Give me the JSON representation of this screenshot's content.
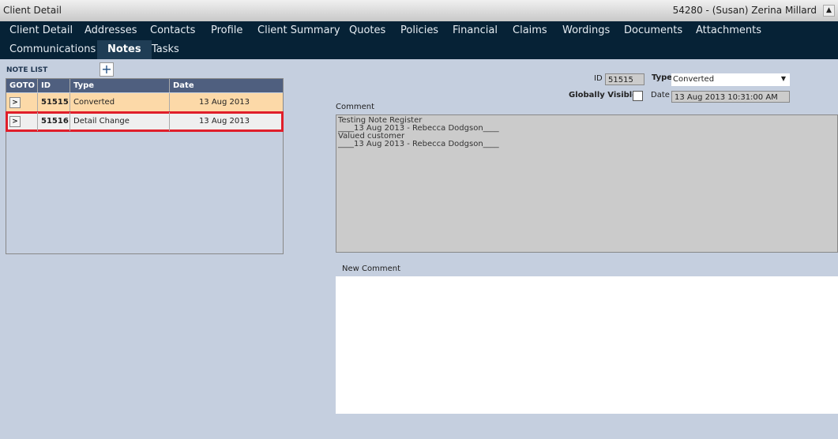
{
  "window": {
    "title": "Client Detail",
    "client": "54280 - (Susan) Zerina Millard",
    "collapse_icon": "chevron-up-icon"
  },
  "tabs": [
    "Client Detail",
    "Addresses",
    "Contacts",
    "Profile",
    "Client Summary",
    "Quotes",
    "Policies",
    "Financial",
    "Claims",
    "Wordings",
    "Documents",
    "Attachments",
    "Communications",
    "Notes",
    "Tasks"
  ],
  "active_tab": "Notes",
  "note_list": {
    "label": "NOTE LIST",
    "add": "+",
    "columns": [
      "GOTO",
      "ID",
      "Type",
      "Date"
    ],
    "rows": [
      {
        "goto": ">",
        "id": "51515",
        "type": "Converted",
        "date": "13 Aug 2013"
      },
      {
        "goto": ">",
        "id": "51516",
        "type": "Detail Change",
        "date": "13 Aug 2013"
      }
    ]
  },
  "detail": {
    "id_label": "ID",
    "id": "51515",
    "type_label": "Type",
    "type": "Converted",
    "visible_label": "Globally Visible",
    "date_label": "Date",
    "date": "13 Aug 2013 10:31:00 AM",
    "comment_label": "Comment",
    "comment_lines": [
      "Testing Note Register",
      "____13 Aug 2013 - Rebecca Dodgson____",
      "Valued customer",
      "____13 Aug 2013 - Rebecca Dodgson____"
    ],
    "new_comment_label": "New Comment",
    "new_comment": ""
  },
  "colors": {
    "nav": "#062236",
    "selected_row": "#fcd9a8",
    "highlight": "#e01e2a"
  }
}
